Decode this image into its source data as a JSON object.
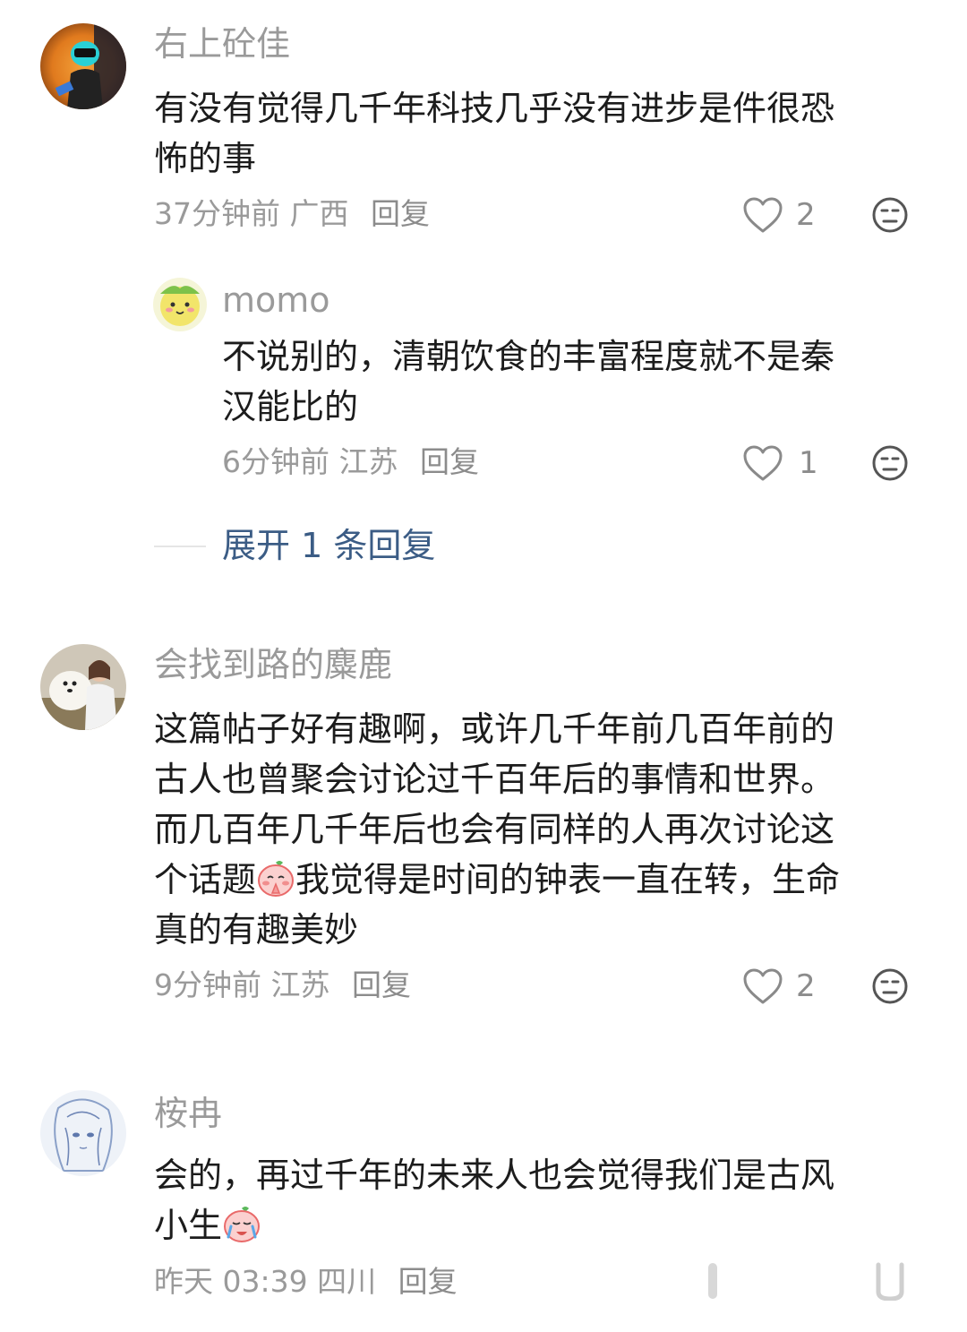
{
  "comments": [
    {
      "username": "右上砼佳",
      "lines": [
        "有没有觉得几千年科技几乎没有进步是件很恐",
        "怖的事"
      ],
      "time": "37分钟前",
      "location": "广西",
      "reply_label": "回复",
      "likes": "2",
      "replies": [
        {
          "username": "momo",
          "lines": [
            "不说别的，清朝饮食的丰富程度就不是秦",
            "汉能比的"
          ],
          "time": "6分钟前",
          "location": "江苏",
          "reply_label": "回复",
          "likes": "1"
        }
      ],
      "expand_label": "展开 1 条回复"
    },
    {
      "username": "会找到路的麋鹿",
      "lines": [
        "这篇帖子好有趣啊，或许几千年前几百年前的",
        "古人也曾聚会讨论过千百年后的事情和世界。",
        "而几百年几千年后也会有同样的人再次讨论这"
      ],
      "line4_before": "个话题",
      "line4_after": "我觉得是时间的钟表一直在转，生命",
      "line5": "真的有趣美妙",
      "time": "9分钟前",
      "location": "江苏",
      "reply_label": "回复",
      "likes": "2"
    },
    {
      "username": "桉冉",
      "line1": "会的，再过千年的未来人也会觉得我们是古风",
      "line2_before": "小生",
      "time": "昨天 03:39",
      "location": "四川",
      "reply_label": "回复"
    }
  ],
  "icons": {
    "like": "heart-outline-icon",
    "react": "neutral-face-icon",
    "emoji_pray": "peach-pray-emoji",
    "emoji_cry": "peach-cry-emoji"
  },
  "colors": {
    "link": "#3b5c85",
    "muted": "#9a9a9a"
  }
}
